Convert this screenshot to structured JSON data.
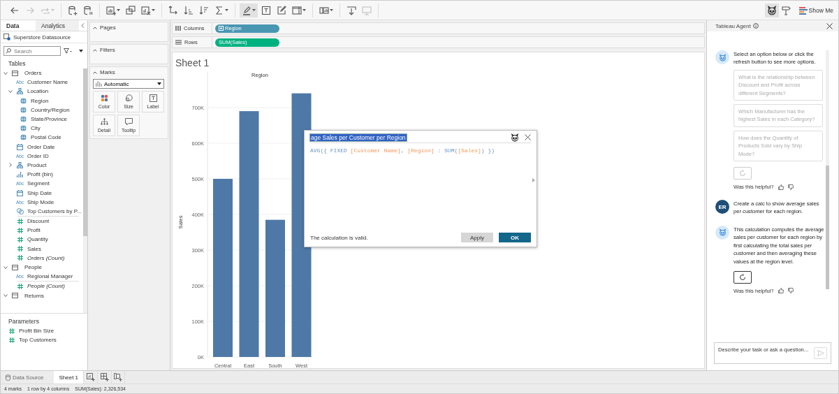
{
  "toolbar": {
    "groups": [
      [
        {
          "kind": "back",
          "disabled": false,
          "menu": false,
          "selected": false
        },
        {
          "kind": "forward",
          "disabled": true,
          "menu": false,
          "selected": false
        },
        {
          "kind": "redo",
          "disabled": true,
          "menu": true,
          "selected": false
        }
      ],
      [
        {
          "kind": "add-datasource",
          "disabled": false,
          "menu": false,
          "selected": false
        },
        {
          "kind": "pause",
          "disabled": false,
          "menu": false,
          "selected": false
        }
      ],
      [
        {
          "kind": "new-sheet",
          "disabled": false,
          "menu": true,
          "selected": false
        },
        {
          "kind": "duplicate",
          "disabled": false,
          "menu": false,
          "selected": false
        },
        {
          "kind": "clear",
          "disabled": false,
          "menu": true,
          "selected": false
        }
      ],
      [
        {
          "kind": "swap",
          "disabled": false,
          "menu": false,
          "selected": false
        },
        {
          "kind": "sort-asc",
          "disabled": false,
          "menu": false,
          "selected": false
        },
        {
          "kind": "sort-desc",
          "disabled": false,
          "menu": false,
          "selected": false
        },
        {
          "kind": "totals",
          "disabled": false,
          "menu": true,
          "selected": false
        }
      ],
      [
        {
          "kind": "highlight",
          "disabled": false,
          "menu": true,
          "selected": true
        },
        {
          "kind": "text-label",
          "disabled": false,
          "menu": false,
          "selected": false
        },
        {
          "kind": "annotate",
          "disabled": false,
          "menu": false,
          "selected": false
        },
        {
          "kind": "fit",
          "disabled": false,
          "menu": true,
          "selected": false
        }
      ],
      [
        {
          "kind": "show-cards",
          "disabled": false,
          "menu": true,
          "selected": false
        }
      ],
      [
        {
          "kind": "download",
          "disabled": false,
          "menu": false,
          "selected": false
        },
        {
          "kind": "presentation",
          "disabled": true,
          "menu": false,
          "selected": false
        }
      ]
    ],
    "right": [
      {
        "kind": "agent",
        "selected": true
      },
      {
        "kind": "tooltip",
        "selected": false
      },
      {
        "kind": "show-me",
        "label": "Show Me",
        "selected": false
      }
    ]
  },
  "data_pane": {
    "tabs": [
      {
        "label": "Data",
        "selected": true
      },
      {
        "label": "Analytics",
        "selected": false
      }
    ],
    "datasource": "Superstore Datasource",
    "search": {
      "placeholder": "Search"
    },
    "tables_heading": "Tables",
    "tables": [
      {
        "name": "Orders",
        "kind": "table",
        "expanded": true,
        "children": [
          {
            "name": "Customer Name",
            "kind": "text",
            "badge": "Abc"
          },
          {
            "name": "Location",
            "kind": "hierarchy",
            "expanded": true,
            "children": [
              {
                "name": "Region",
                "kind": "geo"
              },
              {
                "name": "Country/Region",
                "kind": "geo"
              },
              {
                "name": "State/Province",
                "kind": "geo"
              },
              {
                "name": "City",
                "kind": "geo"
              },
              {
                "name": "Postal Code",
                "kind": "geo"
              }
            ]
          },
          {
            "name": "Order Date",
            "kind": "date"
          },
          {
            "name": "Order ID",
            "kind": "text",
            "badge": "Abc"
          },
          {
            "name": "Product",
            "kind": "hierarchy",
            "expanded": false
          },
          {
            "name": "Profit (bin)",
            "kind": "bin"
          },
          {
            "name": "Segment",
            "kind": "text",
            "badge": "Abc"
          },
          {
            "name": "Ship Date",
            "kind": "date"
          },
          {
            "name": "Ship Mode",
            "kind": "text",
            "badge": "Abc"
          },
          {
            "name": "Top Customers by P...",
            "kind": "set"
          },
          {
            "name": "Discount",
            "kind": "measure"
          },
          {
            "name": "Profit",
            "kind": "measure"
          },
          {
            "name": "Quantity",
            "kind": "measure"
          },
          {
            "name": "Sales",
            "kind": "measure"
          },
          {
            "name": "Orders (Count)",
            "kind": "count"
          }
        ]
      },
      {
        "name": "People",
        "kind": "table",
        "expanded": true,
        "children": [
          {
            "name": "Regional Manager",
            "kind": "text",
            "badge": "Abc"
          },
          {
            "name": "People (Count)",
            "kind": "count"
          }
        ]
      },
      {
        "name": "Returns",
        "kind": "table",
        "expanded": true
      }
    ],
    "parameters_heading": "Parameters",
    "parameters": [
      {
        "name": "Profit Bin Size"
      },
      {
        "name": "Top Customers"
      }
    ]
  },
  "cards": {
    "pages": "Pages",
    "filters": "Filters",
    "marks": {
      "title": "Marks",
      "type": "Automatic",
      "buttons": [
        {
          "kind": "color",
          "label": "Color"
        },
        {
          "kind": "size",
          "label": "Size"
        },
        {
          "kind": "label",
          "label": "Label"
        },
        {
          "kind": "detail",
          "label": "Detail"
        },
        {
          "kind": "tooltip",
          "label": "Tooltip"
        }
      ]
    }
  },
  "shelves": [
    {
      "kind": "columns",
      "label": "Columns",
      "pills": [
        {
          "label": "Region",
          "kind": "dimension",
          "expandable": true
        }
      ]
    },
    {
      "kind": "rows",
      "label": "Rows",
      "pills": [
        {
          "label": "SUM(Sales)",
          "kind": "measure",
          "expandable": false
        }
      ]
    }
  ],
  "sheet": {
    "title": "Sheet 1",
    "chart_data": {
      "type": "bar",
      "title": "Region",
      "ylabel": "Sales",
      "ylim": [
        0,
        800000
      ],
      "categories": [
        "Central",
        "East",
        "South",
        "West"
      ],
      "values": [
        500000,
        690000,
        385000,
        740000
      ],
      "grid": true,
      "yticks": [
        {
          "value": 0,
          "label": "0K"
        },
        {
          "value": 100000,
          "label": "100K"
        },
        {
          "value": 200000,
          "label": "200K"
        },
        {
          "value": 300000,
          "label": "300K"
        },
        {
          "value": 400000,
          "label": "400K"
        },
        {
          "value": 500000,
          "label": "500K"
        },
        {
          "value": 600000,
          "label": "600K"
        },
        {
          "value": 700000,
          "label": "700K"
        }
      ]
    }
  },
  "calc_dialog": {
    "name": {
      "text": "age Sales per Customer per Region",
      "selected": true
    },
    "formula": "AVG({ FIXED [Customer Name], [Region] : SUM([Sales]) })",
    "status": "The calculation is valid.",
    "buttons": [
      {
        "label": "Apply",
        "kind": "secondary"
      },
      {
        "label": "OK",
        "kind": "primary"
      }
    ]
  },
  "agent_panel": {
    "title": "Tableau Agent",
    "messages": [
      {
        "kind": "agent",
        "text": "Select an option below or click the refresh button to see more options.",
        "suggestions": [
          "What is the relationship between Discount and Profit across different Segments?",
          "Which Manufacturer has the highest Sales in each Category?",
          "How does the Quantity of Products Sold vary by Ship Mode?"
        ],
        "refresh": {
          "disabled": true
        },
        "feedback": "Was this helpful?"
      },
      {
        "kind": "user",
        "initials": "ER",
        "text": "Create a calc to show average sales per customer for each region."
      },
      {
        "kind": "agent",
        "text": "This calculation computes the average sales per customer for each region by first calculating the total sales per customer and then averaging these values at the region level.",
        "refresh": {
          "disabled": false
        },
        "feedback": "Was this helpful?"
      }
    ],
    "input": {
      "placeholder": "Describe your task or ask a question..."
    },
    "send": {
      "disabled": true
    }
  },
  "sheet_tabs": [
    {
      "label": "Data Source",
      "kind": "datasource",
      "selected": false
    },
    {
      "label": "Sheet 1",
      "kind": "sheet",
      "selected": true
    }
  ],
  "status_bar": [
    "4 marks",
    "1 row by 4 columns",
    "SUM(Sales): 2,326,534"
  ]
}
